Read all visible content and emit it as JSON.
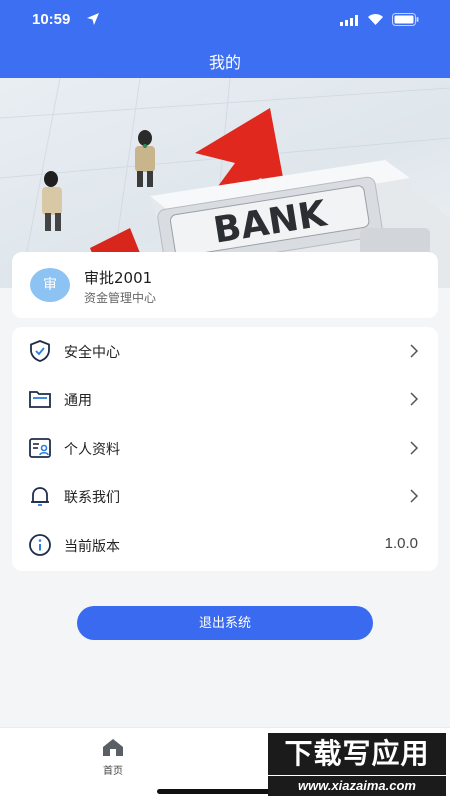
{
  "status_bar": {
    "time": "10:59"
  },
  "header": {
    "title": "我的"
  },
  "banner": {
    "sign_text": "BANK"
  },
  "profile": {
    "avatar_text": "审",
    "name": "审批2001",
    "department": "资金管理中心"
  },
  "menu": {
    "items": [
      {
        "label": "安全中心",
        "icon": "shield-icon"
      },
      {
        "label": "通用",
        "icon": "folder-icon"
      },
      {
        "label": "个人资料",
        "icon": "profile-card-icon"
      },
      {
        "label": "联系我们",
        "icon": "bell-icon"
      },
      {
        "label": "当前版本",
        "icon": "info-icon",
        "value": "1.0.0"
      }
    ]
  },
  "logout": {
    "label": "退出系统"
  },
  "tab_bar": {
    "home_label": "首页"
  },
  "watermark": {
    "title": "下载写应用",
    "url": "www.xiazaima.com"
  },
  "colors": {
    "primary": "#3d6ff2",
    "avatar_bg": "#8cc3f3",
    "icon_navy": "#1f2d4a"
  }
}
